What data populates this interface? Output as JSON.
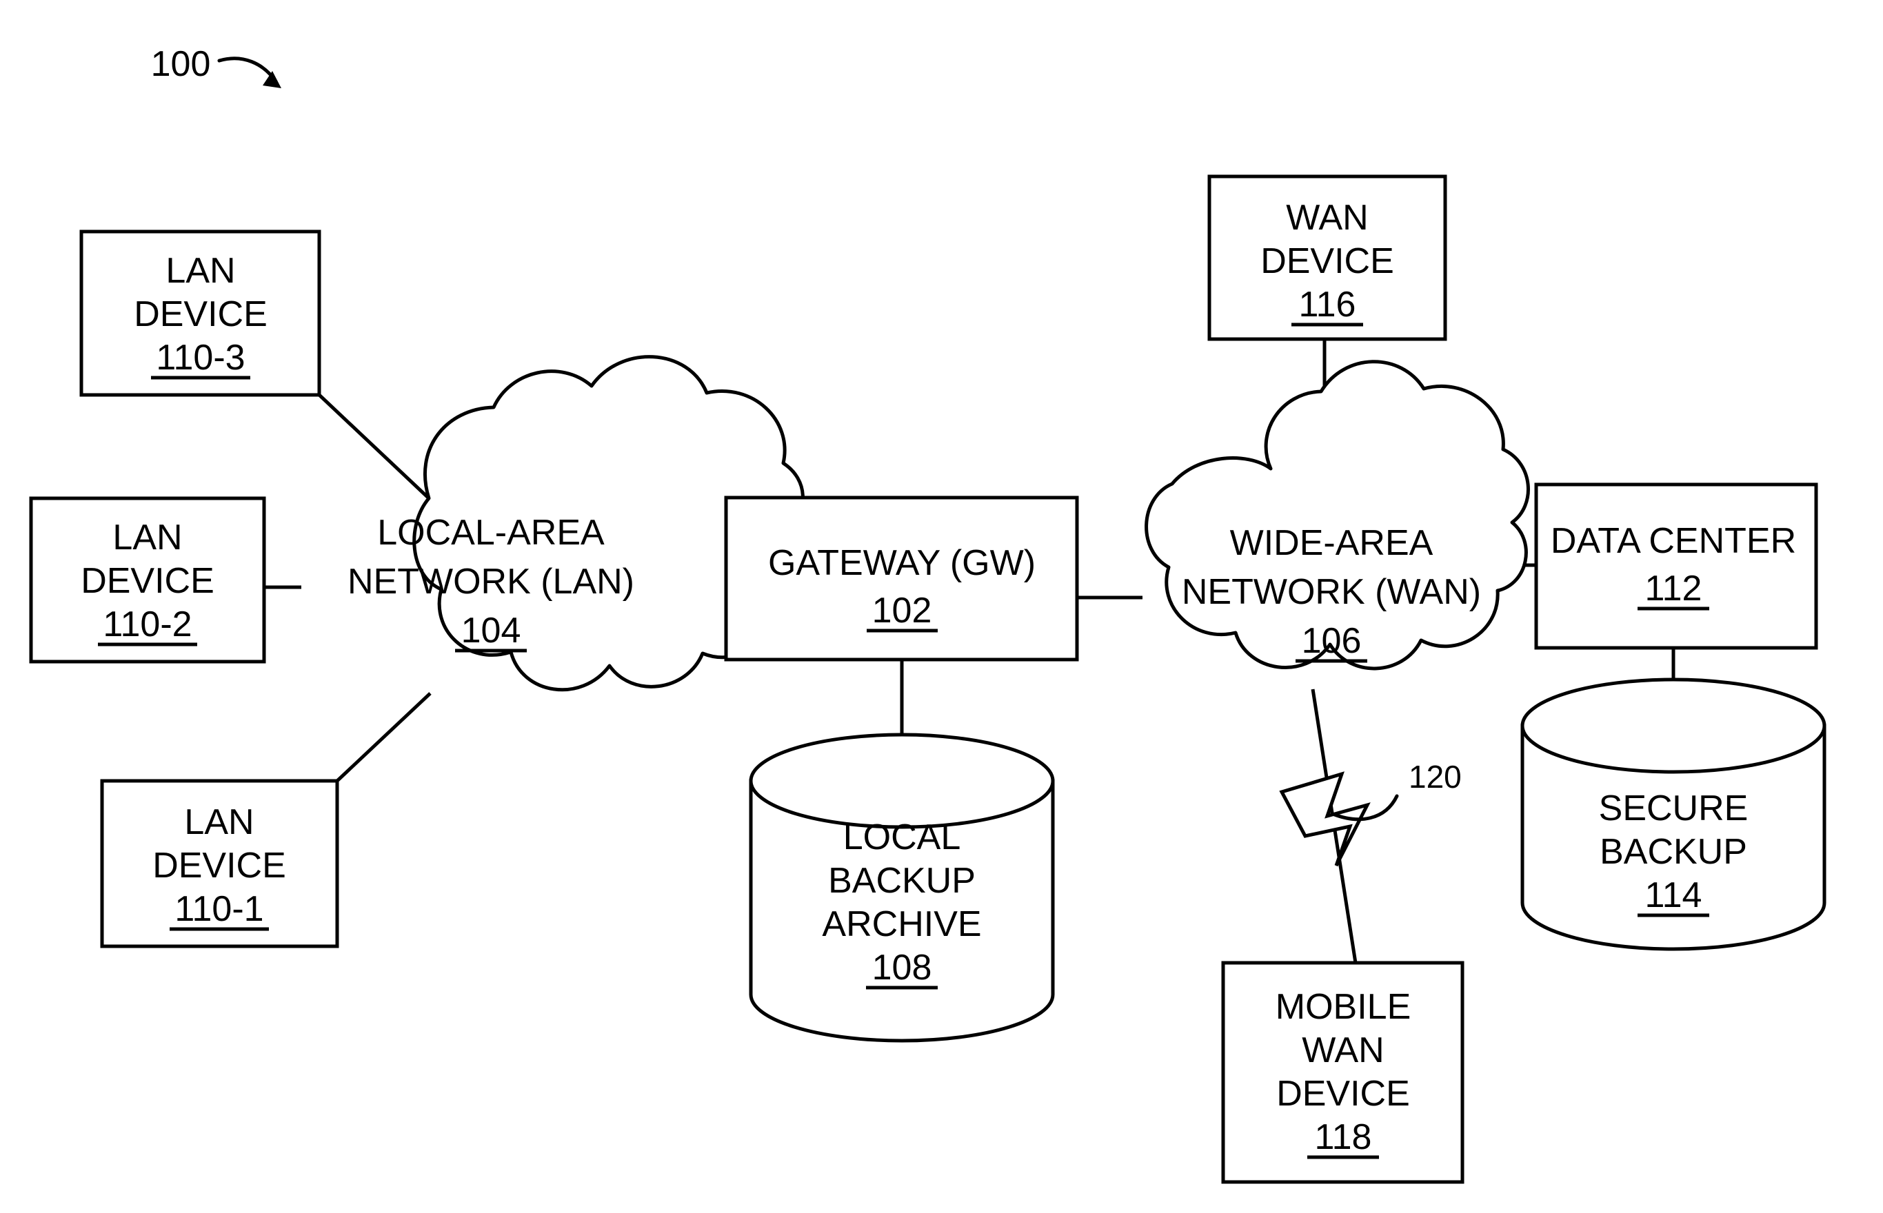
{
  "figure": {
    "number": "100",
    "arrow_icon": "curved-arrow-icon"
  },
  "callouts": [
    {
      "id": "120",
      "label": "120",
      "target": "wireless-link"
    }
  ],
  "nodes": {
    "lan_device_3": {
      "lines": [
        "LAN",
        "DEVICE"
      ],
      "ref": "110-3",
      "shape": "rectangle"
    },
    "lan_device_2": {
      "lines": [
        "LAN",
        "DEVICE"
      ],
      "ref": "110-2",
      "shape": "rectangle"
    },
    "lan_device_1": {
      "lines": [
        "LAN",
        "DEVICE"
      ],
      "ref": "110-1",
      "shape": "rectangle"
    },
    "lan_cloud": {
      "lines": [
        "LOCAL-AREA",
        "NETWORK (LAN)"
      ],
      "ref": "104",
      "shape": "cloud"
    },
    "gateway": {
      "lines": [
        "GATEWAY (GW)"
      ],
      "ref": "102",
      "shape": "rectangle"
    },
    "local_backup_archive": {
      "lines": [
        "LOCAL",
        "BACKUP",
        "ARCHIVE"
      ],
      "ref": "108",
      "shape": "cylinder"
    },
    "wan_cloud": {
      "lines": [
        "WIDE-AREA",
        "NETWORK (WAN)"
      ],
      "ref": "106",
      "shape": "cloud"
    },
    "wan_device": {
      "lines": [
        "WAN",
        "DEVICE"
      ],
      "ref": "116",
      "shape": "rectangle"
    },
    "mobile_wan_device": {
      "lines": [
        "MOBILE",
        "WAN",
        "DEVICE"
      ],
      "ref": "118",
      "shape": "rectangle"
    },
    "data_center": {
      "lines": [
        "DATA CENTER"
      ],
      "ref": "112",
      "shape": "rectangle"
    },
    "secure_backup": {
      "lines": [
        "SECURE",
        "BACKUP"
      ],
      "ref": "114",
      "shape": "cylinder"
    }
  },
  "connections": [
    {
      "from": "lan_device_3",
      "to": "lan_cloud",
      "style": "diagonal-line"
    },
    {
      "from": "lan_device_2",
      "to": "lan_cloud",
      "style": "horizontal-line"
    },
    {
      "from": "lan_device_1",
      "to": "lan_cloud",
      "style": "diagonal-line"
    },
    {
      "from": "lan_cloud",
      "to": "gateway",
      "style": "horizontal-line"
    },
    {
      "from": "gateway",
      "to": "local_backup_archive",
      "style": "vertical-line"
    },
    {
      "from": "gateway",
      "to": "wan_cloud",
      "style": "horizontal-line"
    },
    {
      "from": "wan_device",
      "to": "wan_cloud",
      "style": "vertical-line"
    },
    {
      "from": "wan_cloud",
      "to": "mobile_wan_device",
      "style": "lightning-bolt"
    },
    {
      "from": "wan_cloud",
      "to": "data_center",
      "style": "horizontal-line"
    },
    {
      "from": "data_center",
      "to": "secure_backup",
      "style": "vertical-line"
    }
  ],
  "colors": {
    "stroke": "#000000",
    "fill": "#ffffff",
    "background": "#ffffff"
  }
}
